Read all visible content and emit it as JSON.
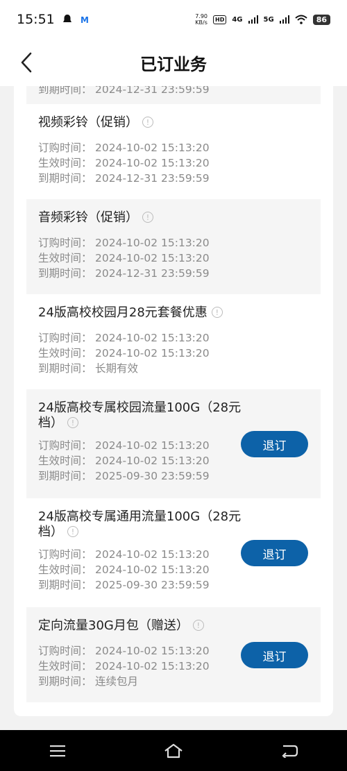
{
  "status_bar": {
    "time": "15:51",
    "speed_value": "7.90",
    "speed_unit": "KB/s",
    "hd": "HD",
    "net1": "4G",
    "net2": "5G",
    "battery": "86"
  },
  "header": {
    "title": "已订业务"
  },
  "partial_top": {
    "label": "到期时间：",
    "value": "2024-12-31 23:59:59"
  },
  "labels": {
    "order_time": "订购时间：",
    "effective_time": "生效时间：",
    "expire_time": "到期时间："
  },
  "services": [
    {
      "name": "视频彩铃（促销）",
      "order_time": "2024-10-02 15:13:20",
      "effective_time": "2024-10-02 15:13:20",
      "expire_time": "2024-12-31 23:59:59"
    },
    {
      "name": "音频彩铃（促销）",
      "order_time": "2024-10-02 15:13:20",
      "effective_time": "2024-10-02 15:13:20",
      "expire_time": "2024-12-31 23:59:59"
    },
    {
      "name": "24版高校校园月28元套餐优惠",
      "order_time": "2024-10-02 15:13:20",
      "effective_time": "2024-10-02 15:13:20",
      "expire_time": "长期有效"
    },
    {
      "name": "24版高校专属校园流量100G（28元档）",
      "order_time": "2024-10-02 15:13:20",
      "effective_time": "2024-10-02 15:13:20",
      "expire_time": "2025-09-30 23:59:59",
      "action": "退订"
    },
    {
      "name": "24版高校专属通用流量100G（28元档）",
      "order_time": "2024-10-02 15:13:20",
      "effective_time": "2024-10-02 15:13:20",
      "expire_time": "2025-09-30 23:59:59",
      "action": "退订"
    },
    {
      "name": "定向流量30G月包（赠送）",
      "order_time": "2024-10-02 15:13:20",
      "effective_time": "2024-10-02 15:13:20",
      "expire_time": "连续包月",
      "action": "退订"
    }
  ],
  "colors": {
    "accent": "#0d62a8",
    "card_gray": "#f5f5f5",
    "text_secondary": "#8a8a8a"
  }
}
